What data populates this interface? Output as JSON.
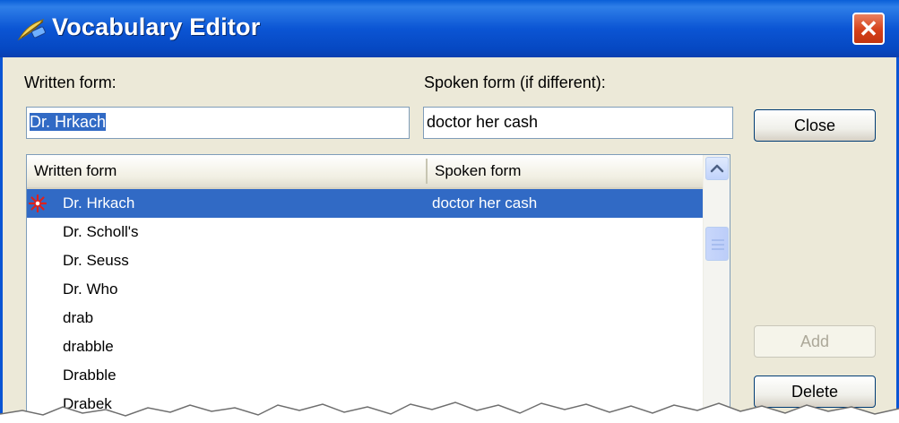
{
  "window": {
    "title": "Vocabulary Editor",
    "close_glyph": "✕",
    "title_icon": "feather-pen-icon"
  },
  "form": {
    "written_label": "Written form:",
    "written_value": "Dr. Hrkach",
    "spoken_label": "Spoken form (if different):",
    "spoken_value": "doctor her cash"
  },
  "buttons": {
    "close": "Close",
    "add": "Add",
    "delete": "Delete"
  },
  "list": {
    "columns": [
      "Written form",
      "Spoken form"
    ],
    "rows": [
      {
        "written": "Dr. Hrkach",
        "spoken": "doctor her cash",
        "selected": true,
        "user_added": true
      },
      {
        "written": "Dr. Scholl's",
        "spoken": ""
      },
      {
        "written": "Dr. Seuss",
        "spoken": ""
      },
      {
        "written": "Dr. Who",
        "spoken": ""
      },
      {
        "written": "drab",
        "spoken": ""
      },
      {
        "written": "drabble",
        "spoken": ""
      },
      {
        "written": "Drabble",
        "spoken": ""
      },
      {
        "written": "Drabek",
        "spoken": ""
      }
    ]
  },
  "colors": {
    "title_bar": "#0b55d4",
    "selection": "#316ac5",
    "close_button": "#d5401a",
    "dialog_face": "#ece9d8",
    "user_word_star": "#e0201a"
  }
}
